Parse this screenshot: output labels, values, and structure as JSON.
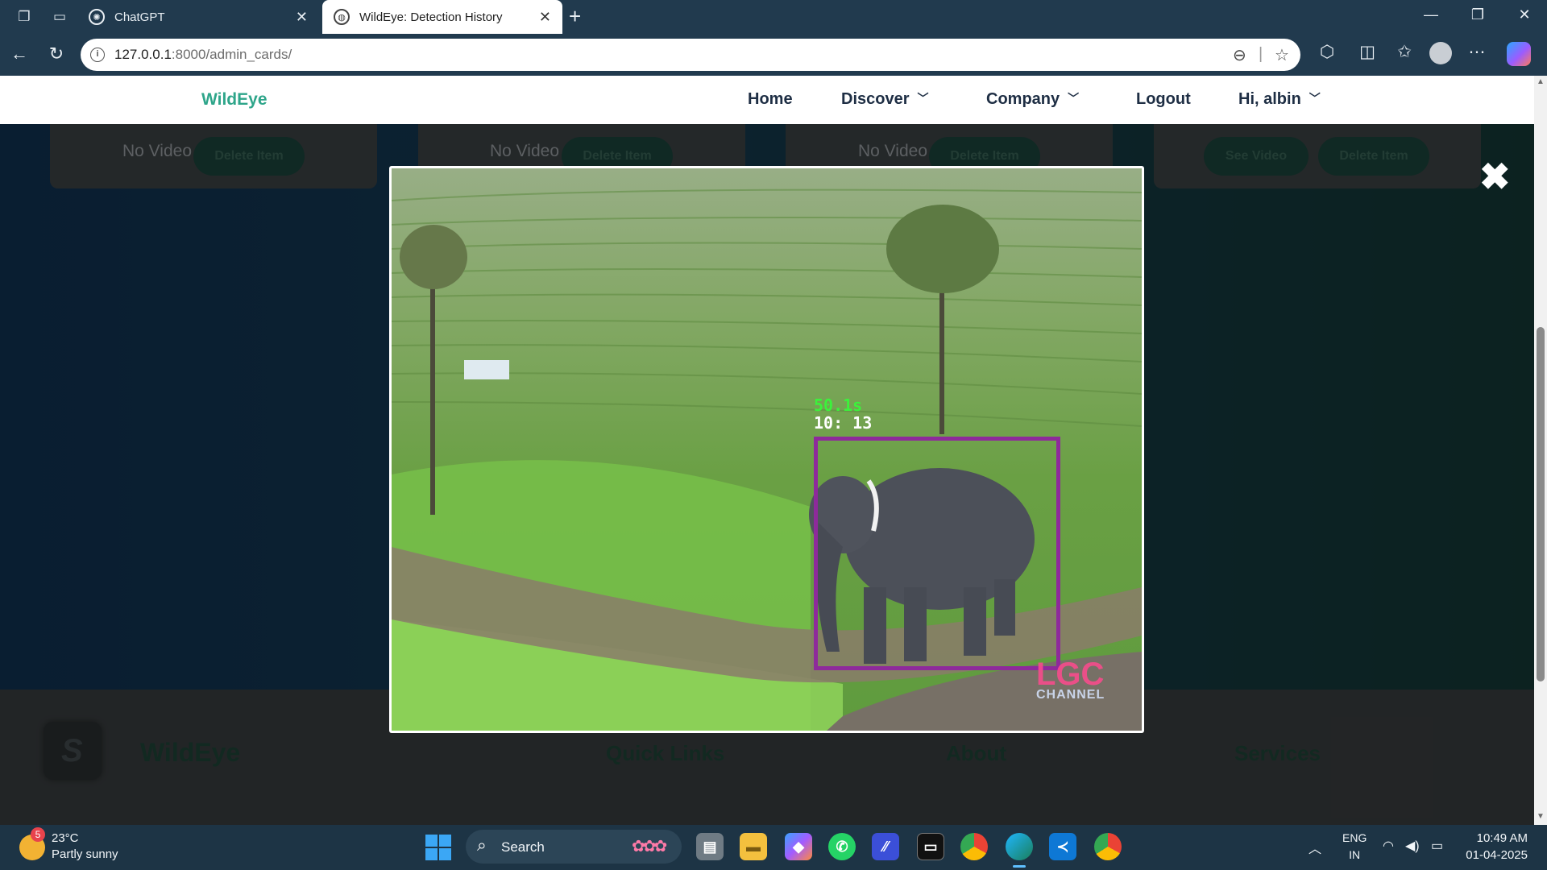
{
  "browser": {
    "tabs": [
      {
        "title": "ChatGPT",
        "active": false
      },
      {
        "title": "WildEye: Detection History",
        "active": true
      }
    ],
    "url_host": "127.0.0.1",
    "url_path": ":8000/admin_cards/"
  },
  "site": {
    "brand": "WildEye",
    "nav": {
      "home": "Home",
      "discover": "Discover",
      "company": "Company",
      "logout": "Logout",
      "user": "Hi, albin"
    },
    "cards": [
      {
        "no_video": "No Video",
        "delete_label": "Delete Item"
      },
      {
        "no_video": "No Video",
        "delete_label": "Delete Item"
      },
      {
        "no_video": "No Video",
        "delete_label": "Delete Item"
      },
      {
        "see_label": "See Video",
        "delete_label": "Delete Item"
      }
    ],
    "footer": {
      "brand": "WildEye",
      "quick_links": "Quick Links",
      "about": "About",
      "services": "Services"
    }
  },
  "modal": {
    "close_glyph": "✖",
    "detection": {
      "label_line1": "50.1s",
      "label_line2": "10: 13"
    },
    "watermark": "LGC",
    "watermark_sub": "CHANNEL"
  },
  "taskbar": {
    "weather_badge": "5",
    "temperature": "23°C",
    "condition": "Partly sunny",
    "search_label": "Search",
    "lang_top": "ENG",
    "lang_bottom": "IN",
    "time": "10:49 AM",
    "date": "01-04-2025"
  },
  "colors": {
    "brand": "#2ea58a",
    "bbox": "#8e2a9b",
    "detection_text": "#3bf23b"
  }
}
